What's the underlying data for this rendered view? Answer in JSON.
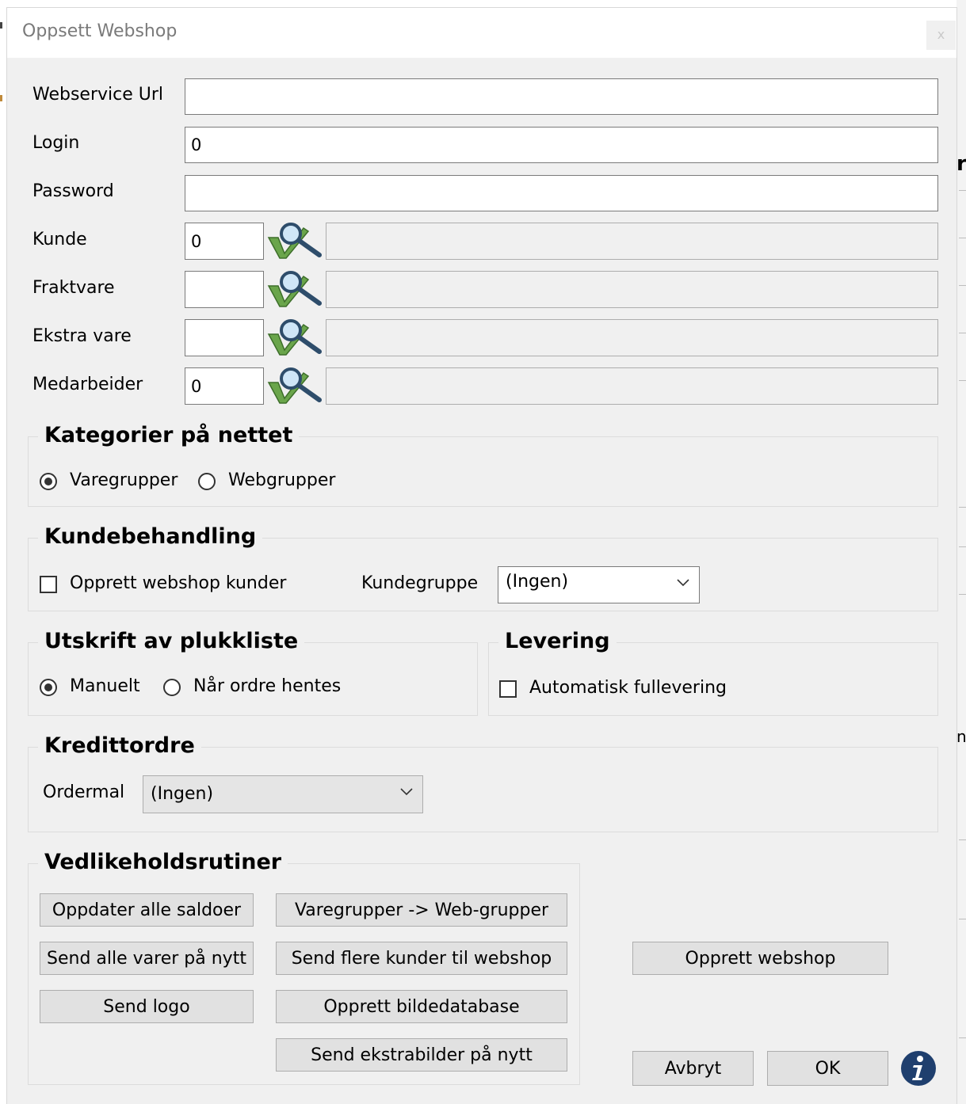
{
  "window": {
    "title": "Oppsett Webshop",
    "close_symbol": "x"
  },
  "fields": {
    "webservice_url": {
      "label": "Webservice Url",
      "value": ""
    },
    "login": {
      "label": "Login",
      "value": "0"
    },
    "password": {
      "label": "Password",
      "value": ""
    },
    "kunde": {
      "label": "Kunde",
      "value": "0",
      "description": ""
    },
    "fraktvare": {
      "label": "Fraktvare",
      "value": "",
      "description": ""
    },
    "ekstra_vare": {
      "label": "Ekstra vare",
      "value": "",
      "description": ""
    },
    "medarbeider": {
      "label": "Medarbeider",
      "value": "0",
      "description": ""
    }
  },
  "kategorier": {
    "title": "Kategorier på nettet",
    "options": [
      {
        "label": "Varegrupper",
        "selected": true
      },
      {
        "label": "Webgrupper",
        "selected": false
      }
    ]
  },
  "kundebehandling": {
    "title": "Kundebehandling",
    "create_customers_label": "Opprett webshop kunder",
    "create_customers_checked": false,
    "kundegruppe_label": "Kundegruppe",
    "kundegruppe_value": "(Ingen)"
  },
  "utskrift": {
    "title": "Utskrift av plukkliste",
    "options": [
      {
        "label": "Manuelt",
        "selected": true
      },
      {
        "label": "Når ordre hentes",
        "selected": false
      }
    ]
  },
  "levering": {
    "title": "Levering",
    "auto_label": "Automatisk fullevering",
    "auto_checked": false
  },
  "kredittordre": {
    "title": "Kredittordre",
    "ordermal_label": "Ordermal",
    "ordermal_value": "(Ingen)"
  },
  "vedlikehold": {
    "title": "Vedlikeholdsrutiner",
    "buttons": {
      "update_balances": "Oppdater alle saldoer",
      "resend_items": "Send alle varer på nytt",
      "send_logo": "Send logo",
      "groups_to_web": "Varegrupper -> Web-grupper",
      "send_customers": "Send flere kunder til webshop",
      "create_image_db": "Opprett bildedatabase",
      "resend_extra_images": "Send ekstrabilder på nytt"
    }
  },
  "actions": {
    "create_webshop": "Opprett webshop",
    "cancel": "Avbryt",
    "ok": "OK"
  },
  "background": {
    "glyph_1": "r",
    "glyph_2": "n"
  },
  "icons": {
    "lookup": "lookup-search-icon",
    "info": "info-icon",
    "chevron": "chevron-down-icon"
  },
  "colors": {
    "info_blue": "#1f3f6e",
    "dialog_bg": "#f0f0f0",
    "button_bg": "#e1e1e1"
  }
}
